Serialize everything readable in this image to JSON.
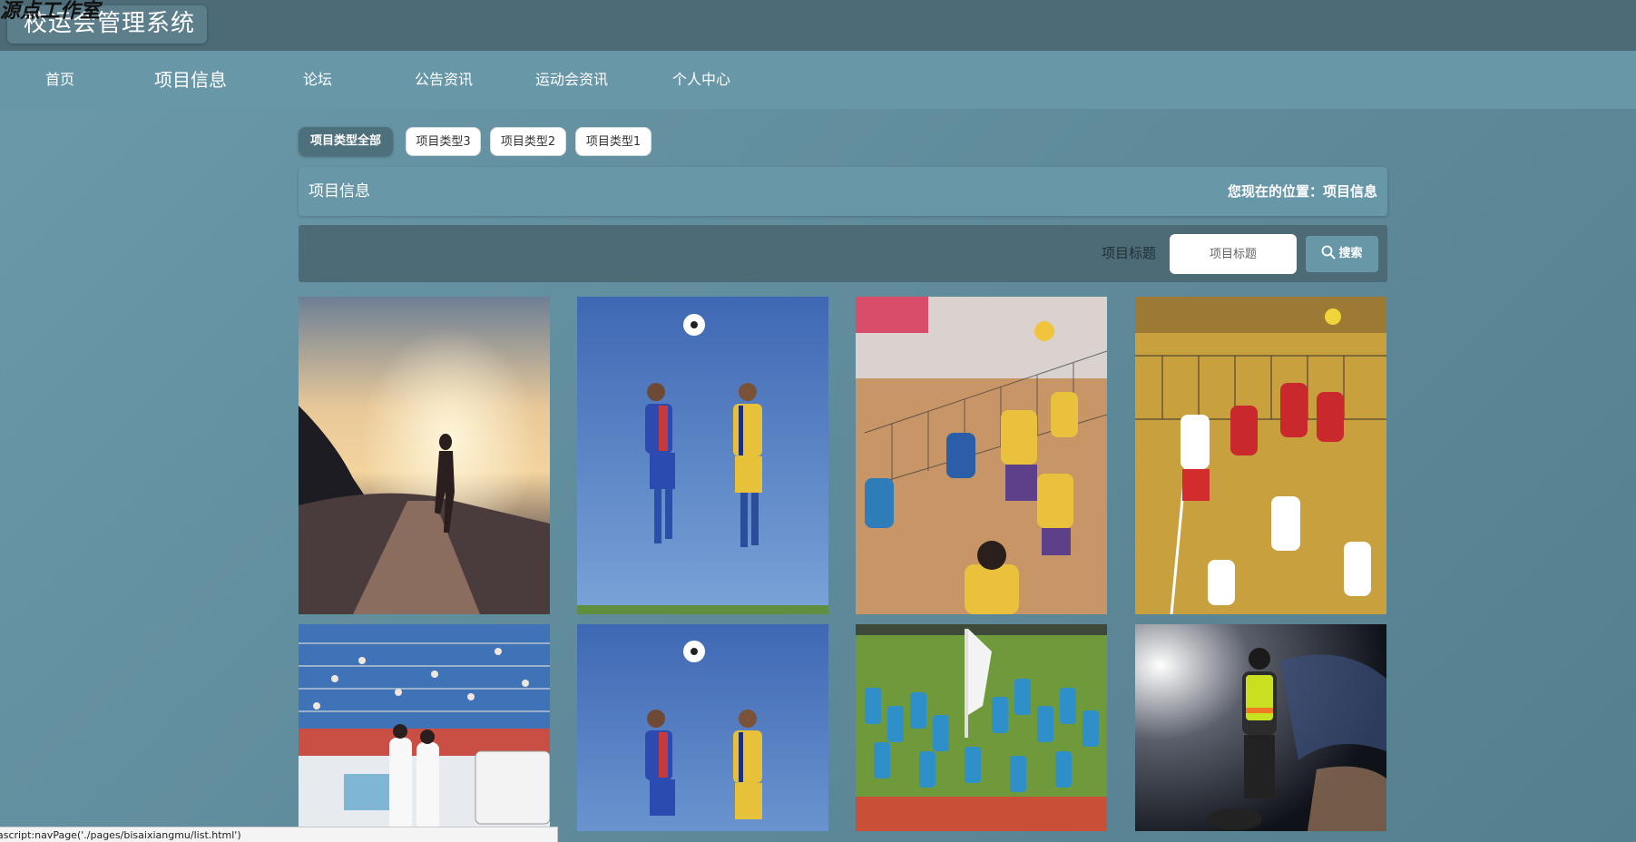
{
  "header": {
    "site_title": "校运会管理系统",
    "watermark": "源点工作室"
  },
  "nav": {
    "items": [
      {
        "label": "首页",
        "active": false
      },
      {
        "label": "项目信息",
        "active": true
      },
      {
        "label": "论坛",
        "active": false
      },
      {
        "label": "公告资讯",
        "active": false
      },
      {
        "label": "运动会资讯",
        "active": false
      },
      {
        "label": "个人中心",
        "active": false
      }
    ]
  },
  "categories": {
    "selected": "项目类型全部",
    "items": [
      "项目类型全部",
      "项目类型3",
      "项目类型2",
      "项目类型1"
    ]
  },
  "breadcrumb": {
    "title": "项目信息",
    "location": "您现在的位置：项目信息"
  },
  "search": {
    "label": "项目标题",
    "placeholder": "项目标题",
    "value": "",
    "button_label": "搜索"
  },
  "grid": {
    "items": [
      {
        "image": "runner-sunset-photo"
      },
      {
        "image": "soccer-header-photo"
      },
      {
        "image": "volleyball-yellow-team-photo"
      },
      {
        "image": "volleyball-red-white-photo"
      },
      {
        "image": "stadium-crowd-photo"
      },
      {
        "image": "soccer-header-photo"
      },
      {
        "image": "track-field-crowd-photo"
      },
      {
        "image": "runner-night-sky-photo"
      }
    ]
  },
  "status_bar": {
    "text": "ascript:navPage('./pages/bisaixiangmu/list.html')"
  },
  "colors": {
    "header_bg": "#4c6b77",
    "nav_bg": "#6897a8",
    "page_bg": "#5f8b9b",
    "selected_category_bg": "#4e6f7c"
  }
}
